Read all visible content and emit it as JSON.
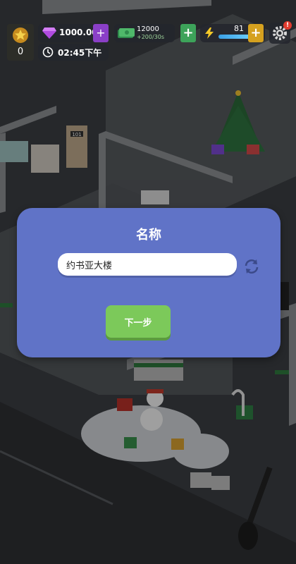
{
  "hud": {
    "level": "0",
    "gems": "1000.00M",
    "cash": "12000",
    "cash_rate": "+200/30s",
    "energy": "81",
    "energy_fraction": 0.81,
    "time": "02:45下午",
    "settings_badge": "!"
  },
  "scene": {
    "room_number": "101"
  },
  "dialog": {
    "title": "名称",
    "name_value": "约书亚大楼",
    "next_label": "下一步"
  },
  "colors": {
    "dialog_bg": "#6073c7",
    "next_button": "#7cc95a",
    "cash_add": "#3da35a",
    "energy_add": "#d5a11f",
    "gem_add": "#8a3fc7"
  }
}
